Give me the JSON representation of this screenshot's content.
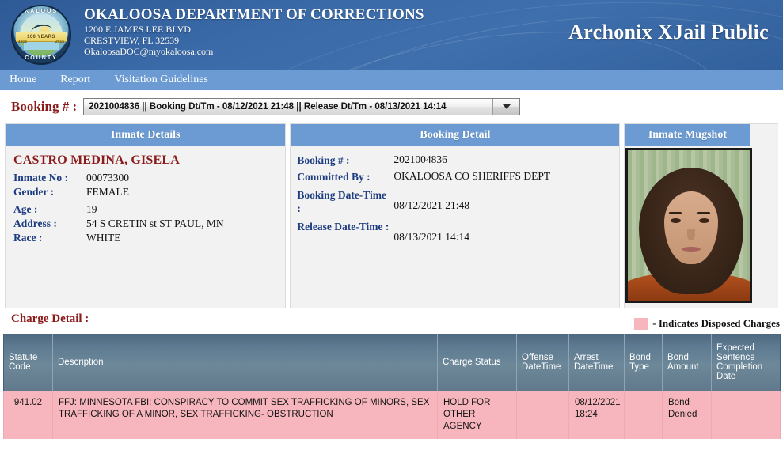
{
  "header": {
    "agency_name": "OKALOOSA DEPARTMENT OF CORRECTIONS",
    "address_line1": "1200 E JAMES LEE BLVD",
    "address_line2": "CRESTVIEW, FL 32539",
    "email": "OkaloosaDOC@myokaloosa.com",
    "app_title": "Archonix XJail Public",
    "seal": {
      "arc_top": "OKALOOSA",
      "arc_bottom": "COUNTY",
      "ribbon": "100 YEARS",
      "year_left": "1915",
      "year_right": "2015"
    }
  },
  "nav": {
    "items": [
      {
        "label": "Home"
      },
      {
        "label": "Report"
      },
      {
        "label": "Visitation Guidelines"
      }
    ]
  },
  "booking_selector": {
    "label": "Booking # :",
    "selected": "2021004836 || Booking Dt/Tm - 08/12/2021 21:48 || Release Dt/Tm - 08/13/2021 14:14",
    "options": [
      "2021004836 || Booking Dt/Tm - 08/12/2021 21:48 || Release Dt/Tm - 08/13/2021 14:14"
    ]
  },
  "inmate_details": {
    "title": "Inmate Details",
    "name": "CASTRO MEDINA, GISELA",
    "fields": [
      {
        "label": "Inmate No :",
        "value": "00073300"
      },
      {
        "label": "Gender :",
        "value": "FEMALE"
      },
      {
        "label": "Age :",
        "value": "19"
      },
      {
        "label": "Address :",
        "value": "54 S CRETIN st ST PAUL, MN"
      },
      {
        "label": "Race :",
        "value": "WHITE"
      }
    ]
  },
  "booking_detail": {
    "title": "Booking Detail",
    "fields": [
      {
        "label": "Booking # :",
        "value": "2021004836"
      },
      {
        "label": "Committed By :",
        "value": "OKALOOSA CO SHERIFFS DEPT"
      },
      {
        "label": "Booking Date-Time :",
        "value": "08/12/2021 21:48"
      },
      {
        "label": "Release Date-Time :",
        "value": "08/13/2021 14:14"
      }
    ]
  },
  "mugshot": {
    "title": "Inmate Mugshot",
    "alt": "inmate-mugshot-photo"
  },
  "charge_detail": {
    "title": "Charge Detail :",
    "legend_text": "- Indicates Disposed Charges",
    "legend_color": "#f7b6bd",
    "columns": [
      "Statute Code",
      "Description",
      "Charge Status",
      "Offense DateTime",
      "Arrest DateTime",
      "Bond Type",
      "Bond Amount",
      "Expected Sentence Completion Date"
    ],
    "rows": [
      {
        "statute_code": "941.02",
        "description": "FFJ: MINNESOTA FBI: CONSPIRACY TO COMMIT SEX TRAFFICKING OF MINORS, SEX TRAFFICKING OF A MINOR, SEX TRAFFICKING- OBSTRUCTION",
        "charge_status": "HOLD FOR OTHER AGENCY",
        "offense_datetime": "",
        "arrest_datetime": "08/12/2021 18:24",
        "bond_type": "",
        "bond_amount": "Bond Denied",
        "expected_sentence_completion_date": "",
        "disposed": true
      }
    ]
  },
  "colors": {
    "banner_blue": "#3a6aa8",
    "nav_blue": "#6b9bd2",
    "panel_head_blue": "#6b9bd2",
    "label_blue": "#1e3d80",
    "heading_maroon": "#8b1a1a",
    "table_header_slate": "#5d7a91",
    "disposed_pink": "#f7b6bd"
  }
}
